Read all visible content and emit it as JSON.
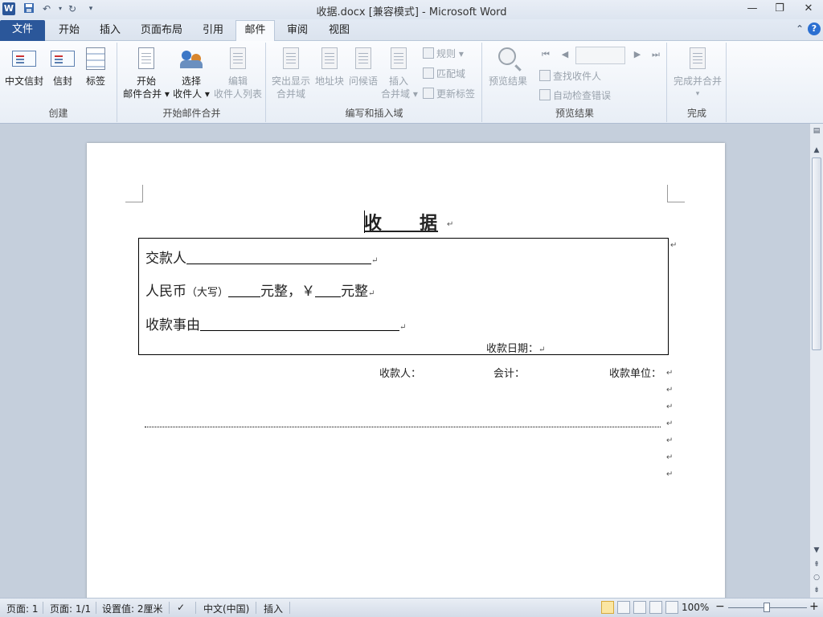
{
  "window": {
    "title": "收据.docx [兼容模式] - Microsoft Word",
    "app_icon": "W",
    "qa_undo": "↶",
    "qa_redo": "↻",
    "minimize": "—",
    "restore": "❐",
    "close": "✕"
  },
  "tabs": [
    {
      "label": "文件"
    },
    {
      "label": "开始"
    },
    {
      "label": "插入"
    },
    {
      "label": "页面布局"
    },
    {
      "label": "引用"
    },
    {
      "label": "邮件"
    },
    {
      "label": "审阅"
    },
    {
      "label": "视图"
    }
  ],
  "help": "?",
  "ribbon": {
    "create": {
      "label": "创建",
      "chinese_envelope": "中文信封",
      "envelope": "信封",
      "labels": "标签"
    },
    "start_merge": {
      "label": "开始邮件合并",
      "start_line1": "开始",
      "start_line2": "邮件合并",
      "select_line1": "选择",
      "select_line2": "收件人",
      "edit_line1": "编辑",
      "edit_line2": "收件人列表"
    },
    "write_insert": {
      "label": "编写和插入域",
      "highlight_line1": "突出显示",
      "highlight_line2": "合并域",
      "address_block": "地址块",
      "greeting": "问候语",
      "insert_line1": "插入",
      "insert_line2": "合并域",
      "rules": "规则",
      "match_fields": "匹配域",
      "update_labels": "更新标签"
    },
    "preview": {
      "label": "预览结果",
      "preview_results": "预览结果",
      "find_recipient": "查找收件人",
      "auto_check": "自动检查错误"
    },
    "finish": {
      "label": "完成",
      "finish_merge": "完成并合并"
    }
  },
  "document": {
    "title": "收　　据",
    "line1_label": "交款人",
    "line2_label": "人民币",
    "line2_daxie": "（大写）",
    "line2_yuan": "元整，￥",
    "line2_yuan2": "元整",
    "line3_label": "收款事由",
    "date_label": "收款日期：",
    "payee": "收款人：",
    "accountant": "会计：",
    "unit": "收款单位：",
    "para_mark": "↵"
  },
  "status": {
    "page": "页面: 1",
    "pages": "页面: 1/1",
    "setting": "设置值: 2厘米",
    "language": "中文(中国)",
    "mode": "插入",
    "zoom": "100%",
    "zoom_minus": "−",
    "zoom_plus": "+"
  }
}
